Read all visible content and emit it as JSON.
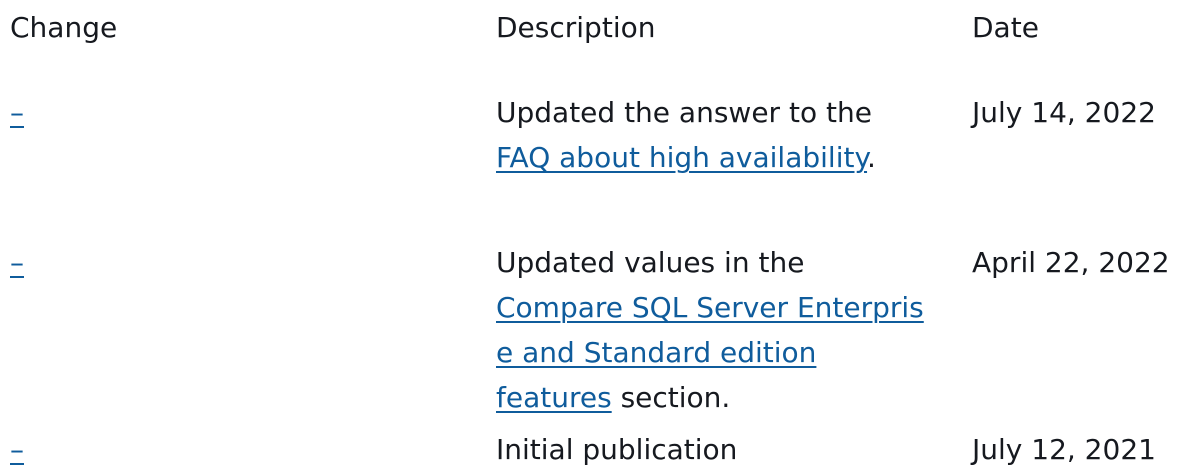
{
  "table": {
    "headers": {
      "change": "Change",
      "description": "Description",
      "date": "Date"
    },
    "rows": [
      {
        "change_link": "–",
        "description": {
          "prefix": "Updated the answer to the",
          "link": "FAQ about high availability",
          "suffix": "."
        },
        "date": "July 14, 2022"
      },
      {
        "change_link": "–",
        "description": {
          "prefix": "Updated values in the",
          "link_lines": [
            "Compare SQL Server Enterpris",
            "e and Standard edition",
            "features"
          ],
          "suffix": " section."
        },
        "date": "April 22, 2022"
      },
      {
        "change_link": "–",
        "description": {
          "text": "Initial publication"
        },
        "date": "July 12, 2021"
      }
    ]
  }
}
